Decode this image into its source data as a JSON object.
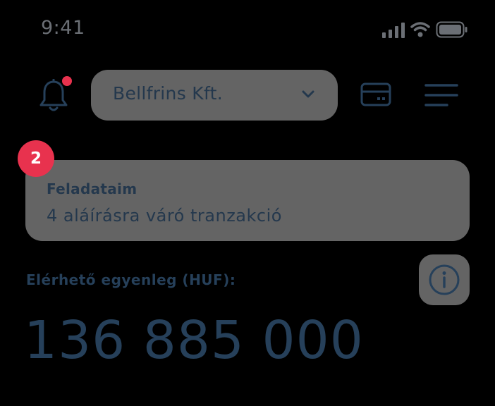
{
  "status_bar": {
    "time": "9:41",
    "icons": [
      "signal-icon",
      "wifi-icon",
      "battery-icon"
    ]
  },
  "header": {
    "notification_icon": "bell-icon",
    "notification_dot_color": "#e8324e",
    "company_select": {
      "value": "Bellfrins Kft.",
      "icon": "chevron-down-icon"
    },
    "card_icon": "card-icon",
    "menu_icon": "menu-icon"
  },
  "tasks": {
    "badge_count": "2",
    "title": "Feladataim",
    "subtitle": "4 aláírásra váró tranzakció"
  },
  "balance": {
    "label": "Elérhető egyenleg (HUF):",
    "amount": "136 885 000",
    "info_icon": "info-icon"
  },
  "colors": {
    "background": "#000000",
    "surface": "#646464",
    "text": "#26405a",
    "accent": "#e8324e"
  }
}
